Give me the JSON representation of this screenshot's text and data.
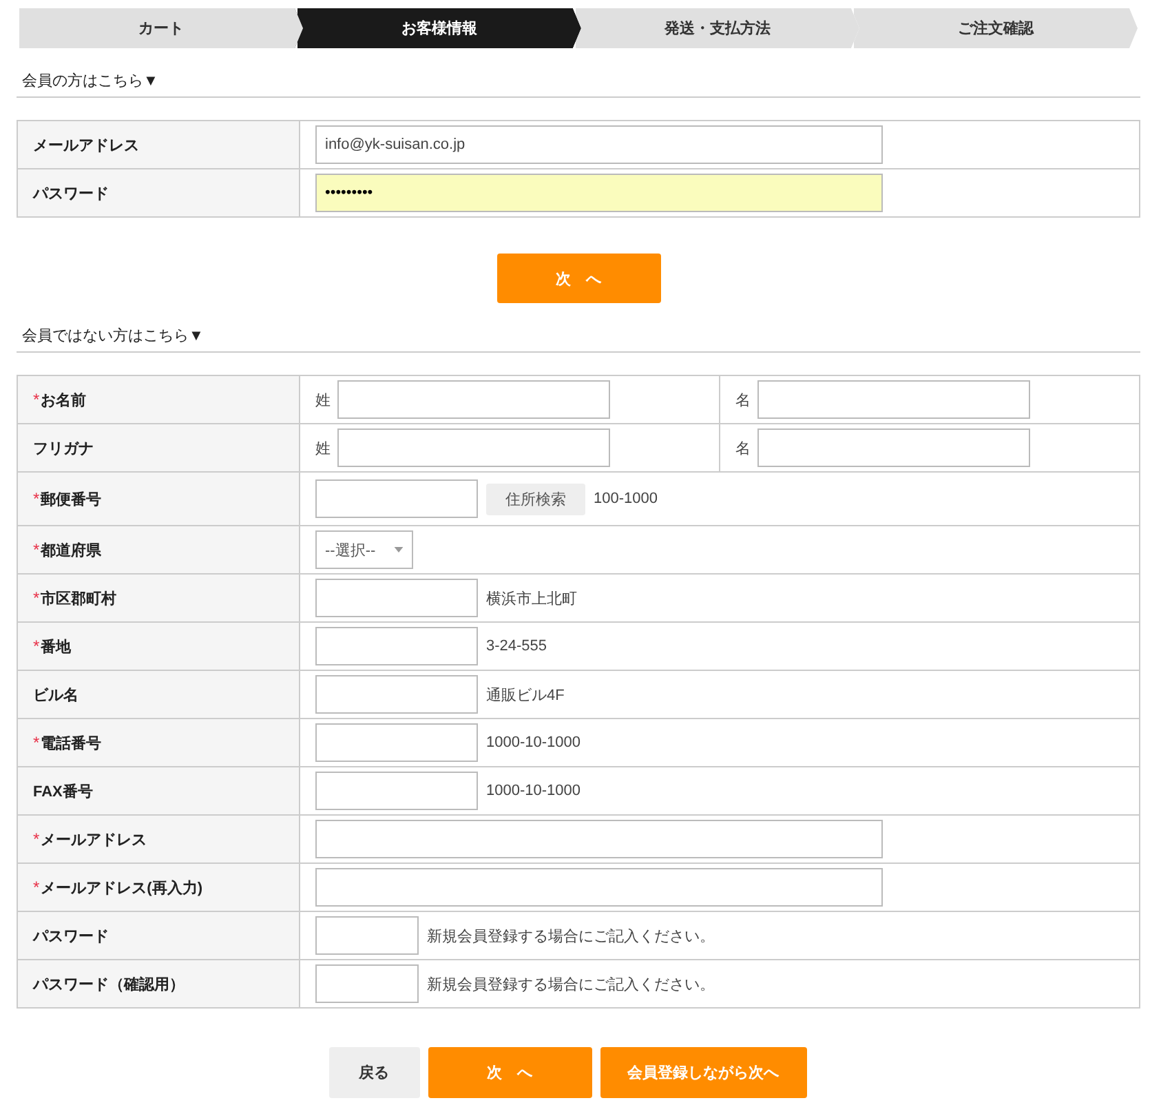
{
  "steps": [
    {
      "label": "カート",
      "selected": false
    },
    {
      "label": "お客様情報",
      "selected": true
    },
    {
      "label": "発送・支払方法",
      "selected": false
    },
    {
      "label": "ご注文確認",
      "selected": false
    }
  ],
  "member_section": {
    "heading": "会員の方はこちら▼",
    "rows": [
      {
        "label": "メールアドレス",
        "value": "info@yk-suisan.co.jp",
        "autofilled": false
      },
      {
        "label": "パスワード",
        "value": "•••••••••",
        "autofilled": true
      }
    ],
    "next_button": "次　へ"
  },
  "guest_section": {
    "heading": "会員ではない方はこちら▼",
    "rows": [
      {
        "label": "お名前",
        "mark": "*",
        "kind": "pair",
        "parts": [
          "姓",
          "名"
        ]
      },
      {
        "label": "フリガナ",
        "kind": "pair",
        "parts": [
          "姓",
          "名"
        ]
      },
      {
        "label": "郵便番号",
        "mark": "*",
        "kind": "zip",
        "button": "住所検索",
        "note": "100-1000"
      },
      {
        "label": "都道府県",
        "mark": "*",
        "kind": "select",
        "value": "--選択--"
      },
      {
        "label": "市区郡町村",
        "mark": "*",
        "kind": "short",
        "note": "横浜市上北町"
      },
      {
        "label": "番地",
        "mark": "*",
        "kind": "short",
        "note": "3-24-555"
      },
      {
        "label": "ビル名",
        "kind": "short",
        "note": "通販ビル4F"
      },
      {
        "label": "電話番号",
        "mark": "*",
        "kind": "short",
        "note": "1000-10-1000"
      },
      {
        "label": "FAX番号",
        "kind": "short",
        "note": "1000-10-1000"
      },
      {
        "label": "メールアドレス",
        "mark": "*",
        "kind": "long"
      },
      {
        "label": "メールアドレス(再入力)",
        "mark": "*",
        "kind": "long"
      },
      {
        "label": "パスワード",
        "kind": "tiny",
        "note": "新規会員登録する場合にご記入ください。"
      },
      {
        "label": "パスワード（確認用）",
        "kind": "tiny",
        "note": "新規会員登録する場合にご記入ください。"
      }
    ]
  },
  "buttons": [
    {
      "label": "戻る",
      "kind": "back"
    },
    {
      "label": "次　へ",
      "kind": "next"
    },
    {
      "label": "会員登録しながら次へ",
      "kind": "register"
    }
  ]
}
